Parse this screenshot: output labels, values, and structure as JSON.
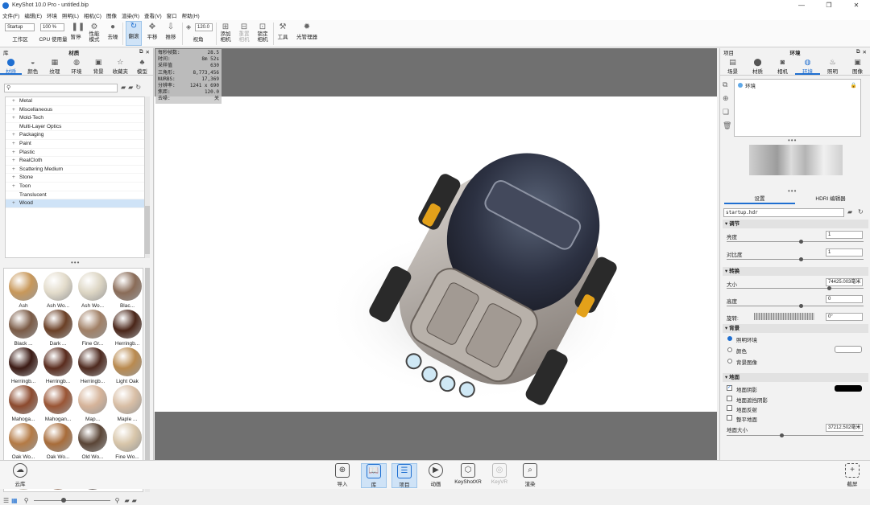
{
  "window": {
    "title": "KeyShot 10.0 Pro  - untitled.bip",
    "min": "—",
    "max": "❐",
    "close": "✕"
  },
  "menu": [
    "文件(F)",
    "编辑(E)",
    "环境",
    "照明(L)",
    "相机(C)",
    "图像",
    "渲染(R)",
    "查看(V)",
    "窗口",
    "帮助(H)"
  ],
  "toolbar": {
    "workspace_select": "Startup",
    "workspace_label": "工作区",
    "cpu_select": "100 %",
    "cpu_label": "CPU 使用量",
    "pause": "暂停",
    "perf_mode": "性能\n模式",
    "denoise": "去噪",
    "refresh": "翻滚",
    "pan": "平移",
    "dolly": "推移",
    "fov_value": "120.0",
    "fov_label": "视角",
    "add_camera": "添加\n相机",
    "reset_camera": "重置\n相机",
    "lock_camera": "锁定\n相机",
    "tools": "工具",
    "light_manager": "光管理器"
  },
  "library": {
    "header_left": "库",
    "header_center": "材质",
    "tabs": [
      "材质",
      "颜色",
      "纹理",
      "环境",
      "背景",
      "收藏夹",
      "模型"
    ],
    "tree": [
      {
        "label": "Metal",
        "expand": "+"
      },
      {
        "label": "Miscellaneous",
        "expand": "+"
      },
      {
        "label": "Mold-Tech",
        "expand": "+"
      },
      {
        "label": "Multi-Layer Optics",
        "expand": ""
      },
      {
        "label": "Packaging",
        "expand": "+"
      },
      {
        "label": "Paint",
        "expand": "+"
      },
      {
        "label": "Plastic",
        "expand": "+"
      },
      {
        "label": "RealCloth",
        "expand": "+"
      },
      {
        "label": "Scattering Medium",
        "expand": "+"
      },
      {
        "label": "Stone",
        "expand": "+"
      },
      {
        "label": "Toon",
        "expand": "+"
      },
      {
        "label": "Translucent",
        "expand": ""
      },
      {
        "label": "Wood",
        "expand": "+"
      }
    ],
    "thumbnails": [
      {
        "label": "Ash",
        "color": "#c8985a"
      },
      {
        "label": "Ash Wo...",
        "color": "#e3dccb"
      },
      {
        "label": "Ash Wo...",
        "color": "#ddd6c4"
      },
      {
        "label": "Blac...",
        "color": "#8a6c58"
      },
      {
        "label": "Black ...",
        "color": "#7a5a45"
      },
      {
        "label": "Dark ...",
        "color": "#6b4026"
      },
      {
        "label": "Fine Gr...",
        "color": "#a18066"
      },
      {
        "label": "Herringb...",
        "color": "#4a2619"
      },
      {
        "label": "Herringb...",
        "color": "#3b1a14"
      },
      {
        "label": "Herringb...",
        "color": "#5a2c1e"
      },
      {
        "label": "Herringb...",
        "color": "#4e2a1f"
      },
      {
        "label": "Light Oak",
        "color": "#b98a4f"
      },
      {
        "label": "Mahoga...",
        "color": "#8c4a2e"
      },
      {
        "label": "Mahogan...",
        "color": "#9a5535"
      },
      {
        "label": "Map...",
        "color": "#d6b49a"
      },
      {
        "label": "Maple ...",
        "color": "#d9bfa6"
      },
      {
        "label": "Oak Wo...",
        "color": "#b47a45"
      },
      {
        "label": "Oak Wo...",
        "color": "#a86c3a"
      },
      {
        "label": "Old Wo...",
        "color": "#5a4536"
      },
      {
        "label": "Fine Wo...",
        "color": "#d8c6aa"
      },
      {
        "label": "",
        "color": "#e6d8bf"
      },
      {
        "label": "",
        "color": "#9a5a33"
      },
      {
        "label": "",
        "color": "#3c2a24"
      }
    ]
  },
  "stats": [
    {
      "k": "每秒帧数:",
      "v": "28.5"
    },
    {
      "k": "时间:",
      "v": "8m 52s"
    },
    {
      "k": "采样值",
      "v": "630"
    },
    {
      "k": "三角形:",
      "v": "8,773,456"
    },
    {
      "k": "NURBS:",
      "v": "17,369"
    },
    {
      "k": "分辨率:",
      "v": "1241 x 690"
    },
    {
      "k": "焦距:",
      "v": "120.0"
    },
    {
      "k": "去噪:",
      "v": "关"
    }
  ],
  "project": {
    "header_left": "项目",
    "header_center": "环境",
    "tabs": [
      "场景",
      "材质",
      "相机",
      "环境",
      "照明",
      "图像"
    ],
    "env_item": "环境",
    "subtabs": [
      "设置",
      "HDRI 编辑器"
    ],
    "hdr_file": "startup.hdr",
    "sections": {
      "adjust": "调节",
      "transform": "转换",
      "background": "背景",
      "ground": "地面"
    },
    "brightness_label": "亮度",
    "brightness": "1",
    "contrast_label": "对比度",
    "contrast": "1",
    "size_label": "大小",
    "size": "74425.003毫米",
    "height_label": "高度",
    "height": "0",
    "rotation_label": "旋转:",
    "rotation": "0°",
    "bg_options": [
      "照明环境",
      "颜色",
      "背景图像"
    ],
    "ground_options": [
      "地面阴影",
      "地面遮挡阴影",
      "地面反射",
      "整平地面"
    ],
    "ground_size_label": "地面大小",
    "ground_size": "37212.502毫米"
  },
  "bottom": {
    "cloud": "云库",
    "items": [
      "导入",
      "库",
      "项目",
      "动画",
      "KeyShotXR",
      "KeyVR",
      "渲染"
    ],
    "screenshot": "截屏"
  }
}
